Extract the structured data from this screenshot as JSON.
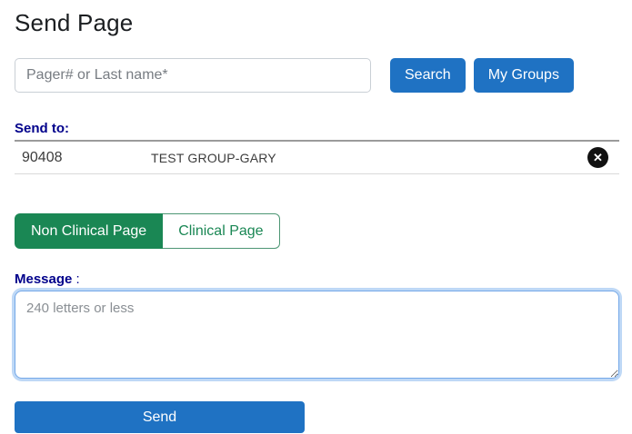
{
  "page": {
    "title": "Send Page"
  },
  "search": {
    "placeholder": "Pager# or Last name*",
    "search_button": "Search",
    "my_groups_button": "My Groups"
  },
  "send_to": {
    "label": "Send to:",
    "recipients": [
      {
        "pager": "90408",
        "name": "TEST GROUP-GARY",
        "remove_icon": "✕"
      }
    ]
  },
  "page_type": {
    "options": [
      {
        "label": "Non Clinical Page",
        "active": true
      },
      {
        "label": "Clinical Page",
        "active": false
      }
    ]
  },
  "message": {
    "label": "Message",
    "colon": ":",
    "placeholder": "240 letters or less",
    "value": ""
  },
  "send": {
    "label": "Send"
  },
  "colors": {
    "primary_blue": "#1f72c3",
    "active_green": "#1a8754",
    "label_navy": "#00008b",
    "textarea_focus_ring": "#bed8f6"
  }
}
